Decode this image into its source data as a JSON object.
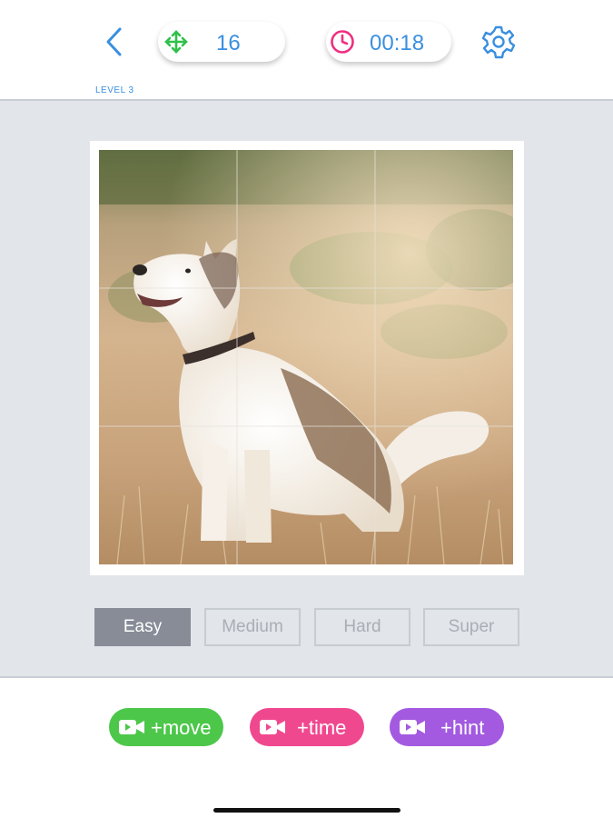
{
  "header": {
    "moves": {
      "icon": "move-arrows-icon",
      "value": "16",
      "color": "#2fc14a"
    },
    "timer": {
      "icon": "clock-icon",
      "value": "00:18",
      "color": "#ee2f80"
    },
    "level_label": "LEVEL 3",
    "accent": "#3a8fe0"
  },
  "puzzle": {
    "image": "husky-dog-photo",
    "grid": {
      "rows": 3,
      "cols": 3
    }
  },
  "difficulty": {
    "options": [
      "Easy",
      "Medium",
      "Hard",
      "Super"
    ],
    "selected": "Easy"
  },
  "bonuses": [
    {
      "label": "+move",
      "icon": "video-camera-icon",
      "color": "#4cc74a"
    },
    {
      "label": "+time",
      "icon": "video-camera-icon",
      "color": "#f0488f"
    },
    {
      "label": "+hint",
      "icon": "video-camera-icon",
      "color": "#a35ae0"
    }
  ]
}
